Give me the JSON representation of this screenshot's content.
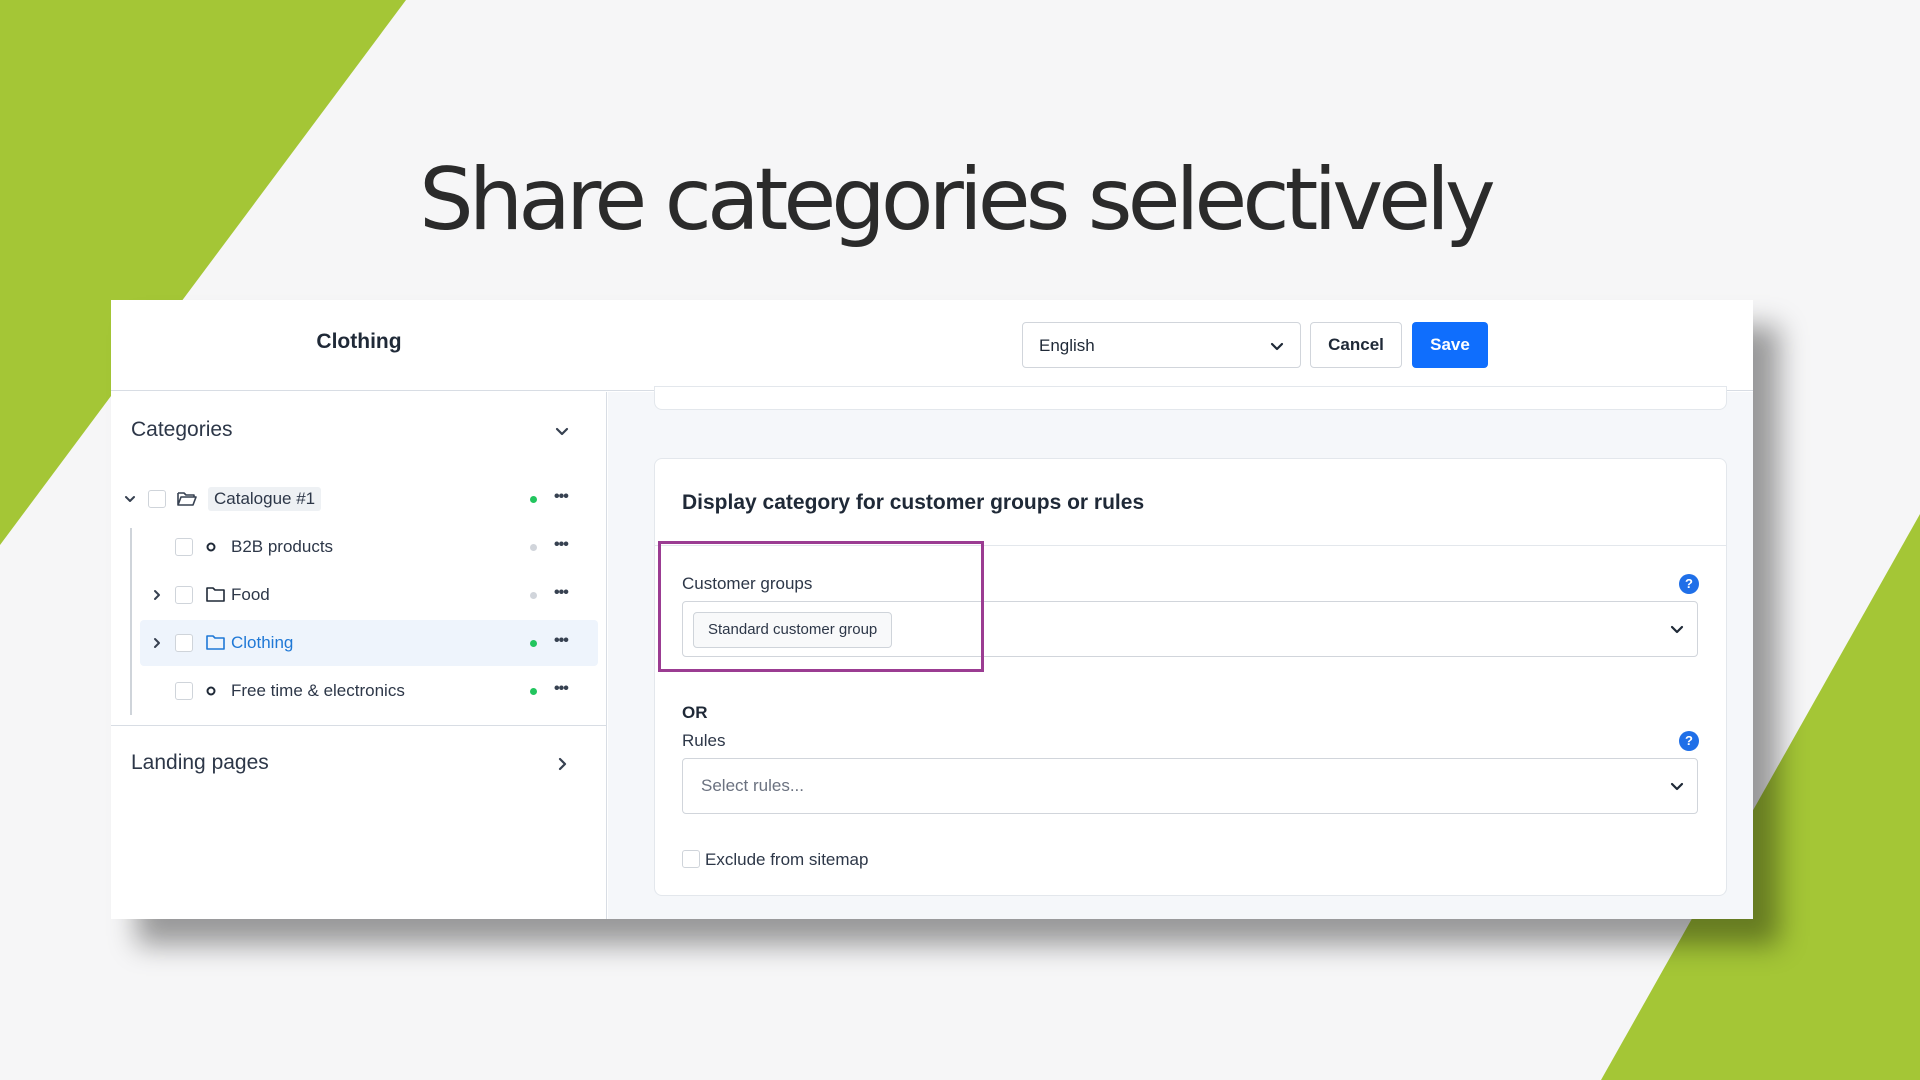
{
  "slide": {
    "title": "Share categories selectively",
    "accent_color": "#a4c636"
  },
  "header": {
    "title": "Clothing",
    "language_select": {
      "value": "English",
      "icon": "chevron-down-icon"
    },
    "cancel_label": "Cancel",
    "save_label": "Save",
    "save_color": "#0f6efd"
  },
  "sidebar": {
    "categories_heading": "Categories",
    "tree": [
      {
        "label": "Catalogue #1",
        "icon": "folder-open-icon",
        "status_color": "#22c55e"
      },
      {
        "label": "B2B products",
        "icon": "circle-icon",
        "status_color": "#d1d5db"
      },
      {
        "label": "Food",
        "icon": "folder-icon",
        "status_color": "#d1d5db"
      },
      {
        "label": "Clothing",
        "icon": "folder-icon",
        "status_color": "#22c55e",
        "selected": true
      },
      {
        "label": "Free time & electronics",
        "icon": "circle-icon",
        "status_color": "#22c55e"
      }
    ],
    "landing_pages_heading": "Landing pages"
  },
  "main": {
    "card_title": "Display category for customer groups or rules",
    "customer_groups": {
      "label": "Customer groups",
      "help": "?",
      "selected": [
        "Standard customer group"
      ]
    },
    "or_label": "OR",
    "rules": {
      "label": "Rules",
      "help": "?",
      "placeholder": "Select rules..."
    },
    "exclude_label": "Exclude from sitemap",
    "highlight_color": "#9b3c92"
  }
}
